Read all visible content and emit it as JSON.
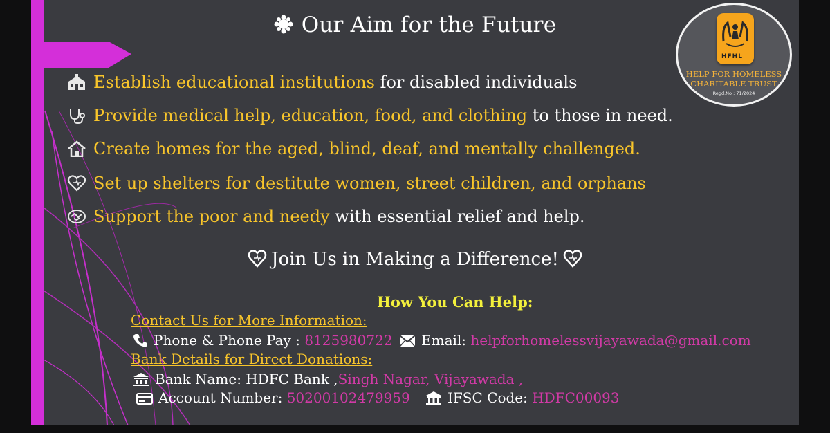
{
  "title": "Our Aim for the Future",
  "aims": [
    {
      "highlight": "Establish educational institutions",
      "rest": " for disabled individuals",
      "icon": "school-icon"
    },
    {
      "highlight": "Provide medical help, education, food, and clothing",
      "rest": " to those in need.",
      "icon": "stethoscope-icon"
    },
    {
      "highlight": "Create homes for the aged, blind, deaf, and mentally challenged.",
      "rest": "",
      "icon": "home-icon"
    },
    {
      "highlight": "Set up shelters for destitute women, street children, and orphans",
      "rest": "",
      "icon": "heart-icon"
    },
    {
      "highlight": "Support the poor and needy",
      "rest": " with essential relief and help.",
      "icon": "handshake-icon"
    }
  ],
  "join": "Join Us in Making a Difference!",
  "how_you_can_help": "How You Can Help:",
  "contact": {
    "heading": "Contact Us for More Information:",
    "phone_label": "Phone & Phone Pay : ",
    "phone": "8125980722",
    "email_label": "Email: ",
    "email": "helpforhomelessvijayawada@gmail.com"
  },
  "bank": {
    "heading": "Bank Details for Direct Donations:",
    "name_label": "Bank Name:  HDFC Bank  ,",
    "branch": "Singh Nagar, Vijayawada ,",
    "account_label": "Account Number: ",
    "account": "50200102479959",
    "ifsc_label": "IFSC Code: ",
    "ifsc": "HDFC00093"
  },
  "logo": {
    "brand": "HFHL",
    "line1": "HELP FOR HOMELESS",
    "line2": "CHARITABLE TRUST",
    "reg": "Regd.No : 71/2024"
  },
  "colors": {
    "background": "#3a3b40",
    "accent_yellow": "#f8c52b",
    "accent_magenta": "#d13aa6",
    "help_heading": "#f3f03c"
  }
}
